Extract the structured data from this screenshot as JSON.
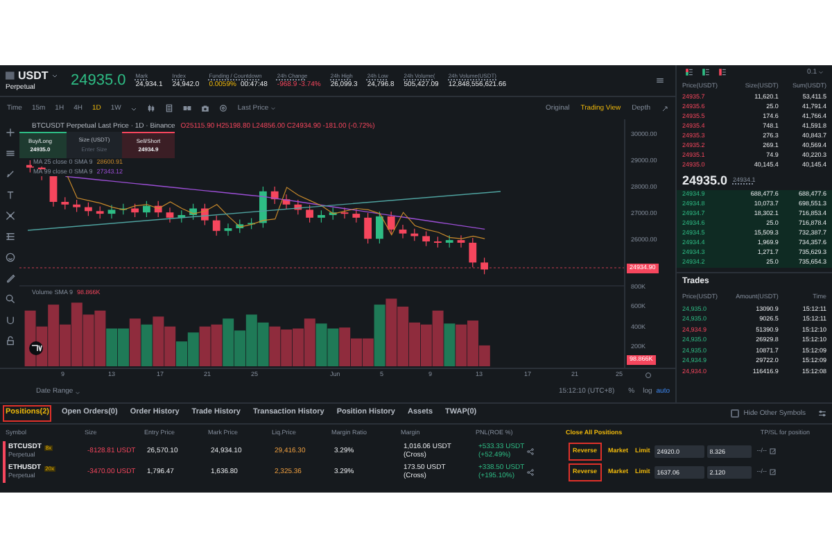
{
  "header": {
    "symbol": "USDT",
    "contract": "Perpetual",
    "last_price": "24935.0",
    "stats": [
      {
        "label": "Mark",
        "value": "24,934.1",
        "kind": "plain"
      },
      {
        "label": "Index",
        "value": "24,942.0",
        "kind": "plain"
      },
      {
        "label": "Funding / Countdown",
        "value": "0.0059%",
        "countdown": "00:47:48",
        "kind": "funding"
      },
      {
        "label": "24h Change",
        "value": "-968.9 -3.74%",
        "kind": "down"
      },
      {
        "label": "24h High",
        "value": "26,099.3",
        "kind": "plain"
      },
      {
        "label": "24h Low",
        "value": "24,796.8",
        "kind": "plain"
      },
      {
        "label": "24h Volume(",
        "value": "505,427.09",
        "kind": "plain"
      },
      {
        "label": "24h Volume(USDT)",
        "value": "12,848,556,621.66",
        "kind": "plain"
      }
    ]
  },
  "toolbar": {
    "intervals": [
      {
        "label": "Time",
        "selected": false
      },
      {
        "label": "15m",
        "selected": false
      },
      {
        "label": "1H",
        "selected": false
      },
      {
        "label": "4H",
        "selected": false
      },
      {
        "label": "1D",
        "selected": true
      },
      {
        "label": "1W",
        "selected": false
      }
    ],
    "price_source": "Last Price",
    "views": [
      {
        "label": "Original",
        "selected": false
      },
      {
        "label": "Trading View",
        "selected": true
      },
      {
        "label": "Depth",
        "selected": false
      }
    ]
  },
  "chart": {
    "title": "BTCUSDT Perpetual Last Price · 1D · Binance",
    "ohlc": "O25115.90 H25198.80 L24856.00 C24934.90 -181.00 (-0.72%)",
    "quick_trade": {
      "buy_label": "Buy/Long",
      "buy_price": "24935.0",
      "size_label": "Size (USDT)",
      "size_placeholder": "Enter Size",
      "sell_label": "Sell/Short",
      "sell_price": "24934.9"
    },
    "indicators": [
      {
        "name": "MA 25 close 0 SMA 9",
        "value": "28600.91"
      },
      {
        "name": "MA 99 close 0 SMA 9",
        "value": "27343.12"
      }
    ],
    "volume_label": "Volume SMA 9",
    "volume_value": "98.866K",
    "price_ticks": [
      "30000.00",
      "29000.00",
      "28000.00",
      "27000.00",
      "26000.00"
    ],
    "price_tag": "24934.90",
    "volume_ticks": [
      "800K",
      "600K",
      "400K",
      "200K"
    ],
    "volume_tag": "98.866K",
    "dates": [
      "9",
      "13",
      "17",
      "21",
      "25",
      "Jun",
      "5",
      "9",
      "13",
      "17",
      "21",
      "25"
    ],
    "date_range": "Date Range",
    "time": "15:12:10 (UTC+8)",
    "percent": "%",
    "log": "log",
    "auto": "auto"
  },
  "order_book": {
    "tick": "0.1",
    "columns": [
      "Price(USDT)",
      "Size(USDT)",
      "Sum(USDT)"
    ],
    "asks": [
      [
        "24935.7",
        "11,620.1",
        "53,411.5"
      ],
      [
        "24935.6",
        "25.0",
        "41,791.4"
      ],
      [
        "24935.5",
        "174.6",
        "41,766.4"
      ],
      [
        "24935.4",
        "748.1",
        "41,591.8"
      ],
      [
        "24935.3",
        "276.3",
        "40,843.7"
      ],
      [
        "24935.2",
        "269.1",
        "40,569.4"
      ],
      [
        "24935.1",
        "74.9",
        "40,220.3"
      ],
      [
        "24935.0",
        "40,145.4",
        "40,145.4"
      ]
    ],
    "last_price": "24935.0",
    "mark_price": "24934.1",
    "bids": [
      [
        "24934.9",
        "688,477.6",
        "688,477.6"
      ],
      [
        "24934.8",
        "10,073.7",
        "698,551.3"
      ],
      [
        "24934.7",
        "18,302.1",
        "716,853.4"
      ],
      [
        "24934.6",
        "25.0",
        "716,878.4"
      ],
      [
        "24934.5",
        "15,509.3",
        "732,387.7"
      ],
      [
        "24934.4",
        "1,969.9",
        "734,357.6"
      ],
      [
        "24934.3",
        "1,271.7",
        "735,629.3"
      ],
      [
        "24934.2",
        "25.0",
        "735,654.3"
      ]
    ]
  },
  "trades": {
    "title": "Trades",
    "columns": [
      "Price(USDT)",
      "Amount(USDT)",
      "Time"
    ],
    "rows": [
      {
        "price": "24,935.0",
        "amount": "13090.9",
        "time": "15:12:11",
        "kind": "buy"
      },
      {
        "price": "24,935.0",
        "amount": "9026.5",
        "time": "15:12:11",
        "kind": "buy"
      },
      {
        "price": "24,934.9",
        "amount": "51390.9",
        "time": "15:12:10",
        "kind": "sell"
      },
      {
        "price": "24,935.0",
        "amount": "26929.8",
        "time": "15:12:10",
        "kind": "buy"
      },
      {
        "price": "24,935.0",
        "amount": "10871.7",
        "time": "15:12:09",
        "kind": "buy"
      },
      {
        "price": "24,934.9",
        "amount": "29722.0",
        "time": "15:12:09",
        "kind": "buy"
      },
      {
        "price": "24,934.0",
        "amount": "116416.9",
        "time": "15:12:08",
        "kind": "sell"
      }
    ]
  },
  "positions": {
    "tabs": [
      {
        "label": "Positions(2)",
        "selected": true,
        "highlighted": true
      },
      {
        "label": "Open Orders(0)",
        "selected": false,
        "highlighted": false
      },
      {
        "label": "Order History",
        "selected": false,
        "highlighted": false
      },
      {
        "label": "Trade History",
        "selected": false,
        "highlighted": false
      },
      {
        "label": "Transaction History",
        "selected": false,
        "highlighted": false
      },
      {
        "label": "Position History",
        "selected": false,
        "highlighted": false
      },
      {
        "label": "Assets",
        "selected": false,
        "highlighted": false
      },
      {
        "label": "TWAP(0)",
        "selected": false,
        "highlighted": false
      }
    ],
    "hide_other": {
      "label": "Hide Other Symbols",
      "checked": false
    },
    "columns": [
      "Symbol",
      "Size",
      "Entry Price",
      "Mark Price",
      "Liq.Price",
      "Margin Ratio",
      "Margin",
      "PNL(ROE %)"
    ],
    "close_all": "Close All Positions",
    "tpsl_header": "TP/SL for position",
    "rows": [
      {
        "symbol": "BTCUSDT",
        "contract": "Perpetual",
        "leverage": "8x",
        "size": "-8128.81 USDT",
        "entry": "26,570.10",
        "mark": "24,934.10",
        "liq": "29,416.30",
        "ratio": "3.29%",
        "margin": "1,016.06 USDT",
        "margin_mode": "(Cross)",
        "pnl": "+533.33 USDT",
        "roe": "(+52.49%)",
        "reverse": "Reverse",
        "reverse_highlighted": true,
        "market": "Market",
        "limit": "Limit",
        "limit_price": "24920.0",
        "limit_qty": "8.326",
        "tpsl": "--/--"
      },
      {
        "symbol": "ETHUSDT",
        "contract": "Perpetual",
        "leverage": "20x",
        "size": "-3470.00 USDT",
        "entry": "1,796.47",
        "mark": "1,636.80",
        "liq": "2,325.36",
        "ratio": "3.29%",
        "margin": "173.50 USDT",
        "margin_mode": "(Cross)",
        "pnl": "+338.50 USDT",
        "roe": "(+195.10%)",
        "reverse": "Reverse",
        "reverse_highlighted": true,
        "market": "Market",
        "limit": "Limit",
        "limit_price": "1637.06",
        "limit_qty": "2.120",
        "tpsl": "--/--"
      }
    ]
  }
}
